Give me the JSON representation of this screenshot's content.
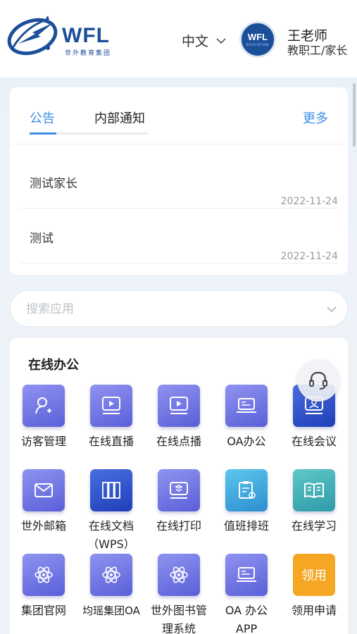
{
  "header": {
    "logo_text": "WFL",
    "logo_sub": "世外教育集团",
    "language": "中文",
    "avatar_text": "WFL",
    "avatar_sub": "EDUCATION",
    "user_name": "王老师",
    "user_role": "教职工/家长"
  },
  "notices": {
    "tabs": [
      {
        "label": "公告",
        "active": true
      },
      {
        "label": "内部通知",
        "active": false
      }
    ],
    "more_label": "更多",
    "items": [
      {
        "title": "测试家长",
        "date": "2022-11-24"
      },
      {
        "title": "测试",
        "date": "2022-11-24"
      }
    ]
  },
  "search": {
    "placeholder": "搜索应用",
    "value": ""
  },
  "apps": {
    "section_title": "在线办公",
    "items": [
      {
        "label": "访客管理",
        "icon": "visitor-icon"
      },
      {
        "label": "在线直播",
        "icon": "live-icon"
      },
      {
        "label": "在线点播",
        "icon": "vod-icon"
      },
      {
        "label": "OA办公",
        "icon": "oa-icon"
      },
      {
        "label": "在线会议",
        "icon": "meeting-icon"
      },
      {
        "label": "世外邮箱",
        "icon": "mail-icon"
      },
      {
        "label": "在线文档\n（WPS）",
        "icon": "docs-icon"
      },
      {
        "label": "在线打印",
        "icon": "print-icon"
      },
      {
        "label": "值班排班",
        "icon": "duty-icon"
      },
      {
        "label": "在线学习",
        "icon": "book-icon"
      },
      {
        "label": "集团官网",
        "icon": "atom-icon"
      },
      {
        "label": "均瑶集团OA",
        "icon": "atom-icon"
      },
      {
        "label": "世外图书管\n理系统",
        "icon": "atom-icon"
      },
      {
        "label": "OA 办公\nAPP",
        "icon": "laptop-icon"
      },
      {
        "label": "领用申请",
        "icon": "claim-icon",
        "badge_text": "领用"
      }
    ]
  },
  "colors": {
    "accent": "#3c8ee8",
    "brand": "#1b4f9a",
    "icon_purple": "#6b6fe0",
    "icon_blue": "#2e4fc8",
    "icon_teal": "#3fa8d8",
    "icon_orange": "#f5a623"
  }
}
